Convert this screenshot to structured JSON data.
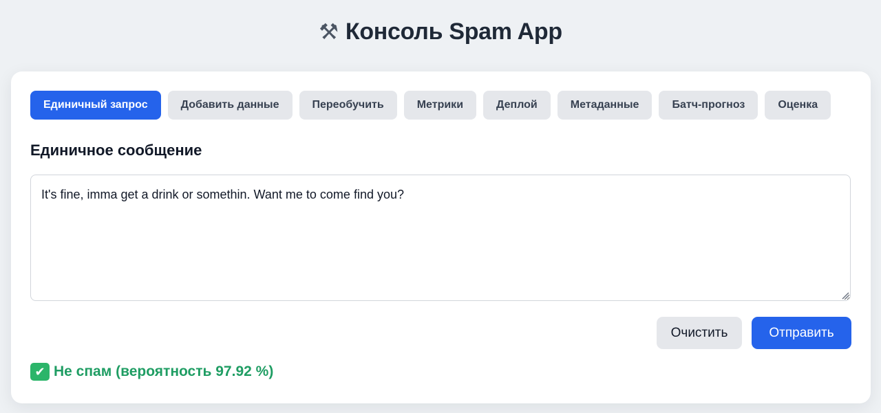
{
  "header": {
    "icon": "hammer-and-wrench-icon",
    "icon_glyph": "⚒",
    "title": "Консоль Spam App"
  },
  "tabs": [
    {
      "label": "Единичный запрос",
      "active": true
    },
    {
      "label": "Добавить данные",
      "active": false
    },
    {
      "label": "Переобучить",
      "active": false
    },
    {
      "label": "Метрики",
      "active": false
    },
    {
      "label": "Деплой",
      "active": false
    },
    {
      "label": "Метаданные",
      "active": false
    },
    {
      "label": "Батч-прогноз",
      "active": false
    },
    {
      "label": "Оценка",
      "active": false
    }
  ],
  "section": {
    "title": "Единичное сообщение"
  },
  "message": {
    "value": "It's fine, imma get a drink or somethin. Want me to come find you?"
  },
  "actions": {
    "clear_label": "Очистить",
    "submit_label": "Отправить"
  },
  "result": {
    "icon": "check-mark-icon",
    "icon_glyph": "✔",
    "text": "Не спам (вероятность 97.92 %)"
  },
  "colors": {
    "accent": "#2563eb",
    "success": "#1f9d63",
    "background": "#eef1f4"
  }
}
